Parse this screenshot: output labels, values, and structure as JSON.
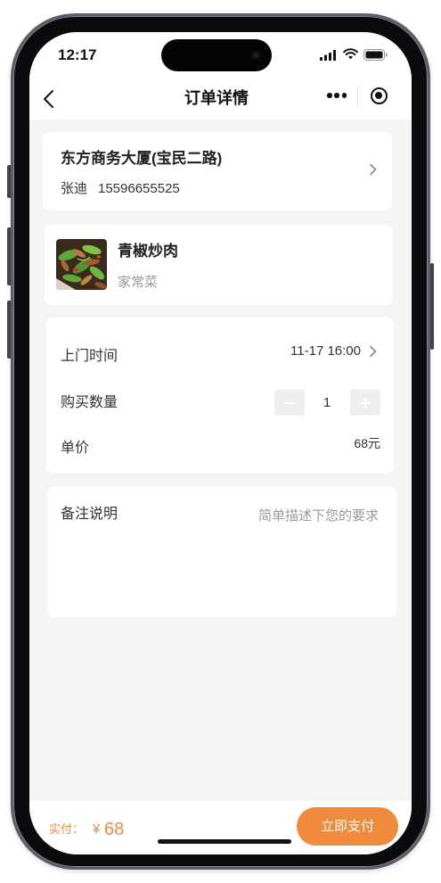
{
  "status_bar": {
    "time": "12:17",
    "icons": [
      "signal-icon",
      "wifi-icon",
      "battery-icon"
    ]
  },
  "nav": {
    "title": "订单详情",
    "back_icon": "chevron-left-icon",
    "menu_icon": "more-dots-icon",
    "exit_icon": "target-circle-icon"
  },
  "address_card": {
    "building": "东方商务大厦(宝民二路)",
    "contact_name": "张迪",
    "contact_phone": "15596655525",
    "arrow_icon": "chevron-right-icon"
  },
  "product_card": {
    "name": "青椒炒肉",
    "category": "家常菜",
    "thumbnail": "dish-photo"
  },
  "order_details": {
    "visit_time": {
      "label": "上门时间",
      "value": "11-17 16:00"
    },
    "quantity": {
      "label": "购买数量",
      "value": "1",
      "decrement_icon": "minus-icon",
      "increment_icon": "plus-icon"
    },
    "unit_price": {
      "label": "单价",
      "value": "68元"
    }
  },
  "remarks": {
    "label": "备注说明",
    "placeholder": "简单描述下您的要求",
    "value": ""
  },
  "footer": {
    "paid_label": "实付：",
    "currency_symbol": "¥",
    "amount": "68",
    "pay_button_label": "立即支付"
  },
  "colors": {
    "accent": "#f08a3c",
    "page_background": "#f4f4f4",
    "card_background": "#ffffff",
    "text_primary": "#222222",
    "text_secondary": "#999999",
    "stepper_background": "#eeeeee"
  }
}
